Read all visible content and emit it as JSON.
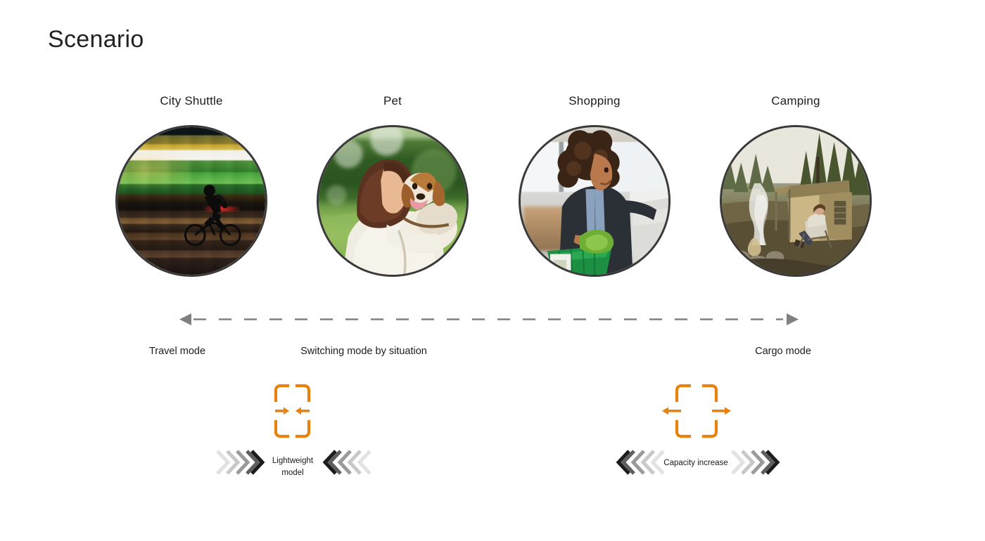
{
  "slide": {
    "title": "Scenario",
    "background_color": "#ffffff"
  },
  "scenarios": [
    {
      "label": "City Shuttle",
      "image_alt": "cyclist-motion-blur-night-street"
    },
    {
      "label": "Pet",
      "image_alt": "woman-holding-beagle-dog-park"
    },
    {
      "label": "Shopping",
      "image_alt": "woman-with-grocery-basket-supermarket"
    },
    {
      "label": "Camping",
      "image_alt": "campsite-tent-campfire-forest"
    }
  ],
  "axis": {
    "left_arrow_icon": "arrow-left-icon",
    "right_arrow_icon": "arrow-right-icon",
    "line_style": "dashed",
    "line_color": "#808080",
    "labels": {
      "left": "Travel mode",
      "center": "Switching mode by situation",
      "right": "Cargo mode"
    }
  },
  "modes": [
    {
      "id": "lightweight",
      "icon_name": "compress-inward-icon",
      "icon_color": "#E8820C",
      "caption": "Lightweight\nmodel",
      "chevron_direction_left": "right",
      "chevron_direction_right": "left",
      "chevron_count": 5
    },
    {
      "id": "capacity",
      "icon_name": "expand-outward-icon",
      "icon_color": "#E8820C",
      "caption": "Capacity increase",
      "chevron_direction_left": "left",
      "chevron_direction_right": "right",
      "chevron_count": 5
    }
  ],
  "colors": {
    "accent_orange": "#E8820C",
    "text_primary": "#1a1a1a",
    "circle_border": "#3a3a3a",
    "axis_gray": "#808080"
  }
}
